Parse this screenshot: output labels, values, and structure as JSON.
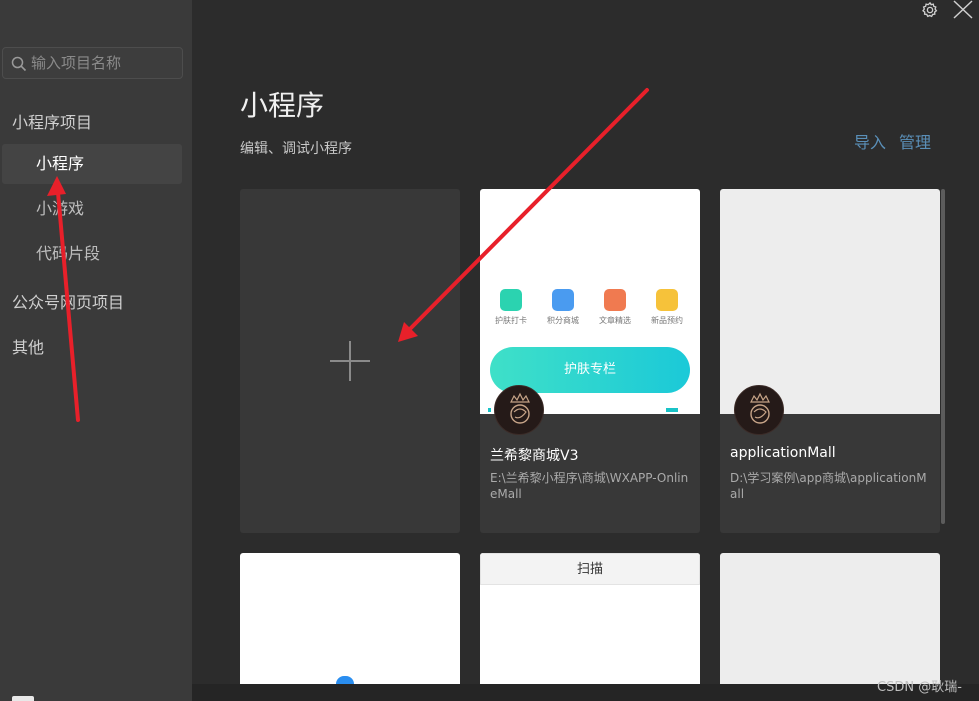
{
  "window": {
    "settings_icon": "gear-icon",
    "close_icon": "close-icon"
  },
  "sidebar": {
    "search": {
      "placeholder": "输入项目名称",
      "value": "",
      "icon": "search-icon"
    },
    "groups": [
      {
        "label": "小程序项目",
        "items": [
          {
            "label": "小程序",
            "active": true
          },
          {
            "label": "小游戏",
            "active": false
          },
          {
            "label": "代码片段",
            "active": false
          }
        ]
      },
      {
        "label": "公众号网页项目",
        "items": []
      },
      {
        "label": "其他",
        "items": []
      }
    ]
  },
  "main": {
    "title": "小程序",
    "subtitle": "编辑、调试小程序",
    "actions": {
      "import_label": "导入",
      "manage_label": "管理"
    },
    "new_card": {
      "icon": "plus-icon"
    },
    "projects": [
      {
        "name": "兰希黎商城V3",
        "path": "E:\\兰希黎小程序\\商城\\WXAPP-OnlineMall",
        "preview": {
          "icon_labels": [
            "护肤打卡",
            "积分商城",
            "文章精选",
            "新品预约"
          ],
          "banner": "护肤专栏"
        }
      },
      {
        "name": "applicationMall",
        "path": "D:\\学习案例\\app商城\\applicationMall"
      }
    ],
    "bottom_cards": {
      "scan_label": "扫描"
    }
  },
  "watermark": "CSDN @耿瑞-",
  "colors": {
    "sidebar_bg": "#3a3a3a",
    "main_bg": "#2c2c2c",
    "card_bg": "#383838",
    "link": "#5a8fb8",
    "arrow": "#e8202a",
    "banner_start": "#3fe0c8",
    "banner_end": "#1bc9d8"
  }
}
